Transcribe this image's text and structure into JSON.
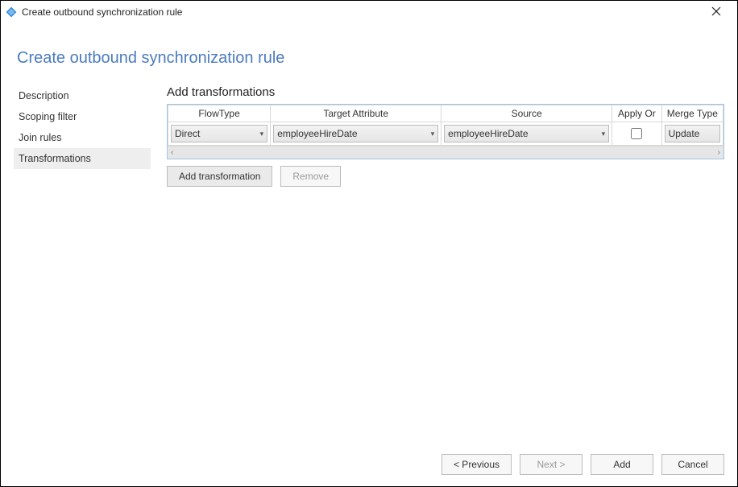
{
  "window": {
    "title": "Create outbound synchronization rule"
  },
  "page": {
    "heading": "Create outbound synchronization rule"
  },
  "sidebar": {
    "items": [
      {
        "label": "Description"
      },
      {
        "label": "Scoping filter"
      },
      {
        "label": "Join rules"
      },
      {
        "label": "Transformations"
      }
    ],
    "selectedIndex": 3
  },
  "main": {
    "section_title": "Add transformations",
    "columns": {
      "flowtype": "FlowType",
      "target": "Target Attribute",
      "source": "Source",
      "apply": "Apply Or",
      "merge": "Merge Type"
    },
    "rows": [
      {
        "flowtype": "Direct",
        "target": "employeeHireDate",
        "source": "employeeHireDate",
        "applyOnce": false,
        "merge": "Update"
      }
    ],
    "buttons": {
      "add_transformation": "Add transformation",
      "remove": "Remove"
    }
  },
  "footer": {
    "previous": "< Previous",
    "next": "Next >",
    "add": "Add",
    "cancel": "Cancel"
  }
}
